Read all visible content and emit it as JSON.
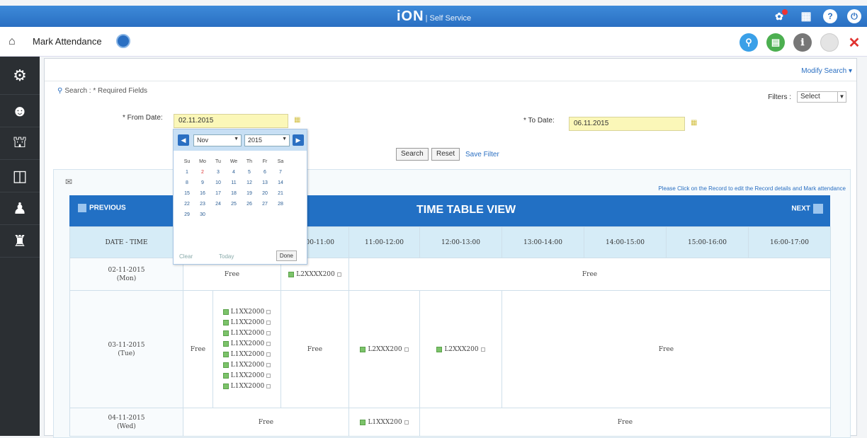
{
  "topbar": {
    "brand": "iON",
    "brand_sub": "| Self Service"
  },
  "header": {
    "title": "Mark Attendance"
  },
  "search": {
    "modify_label": "Modify Search ▾",
    "heading": "Search : * Required Fields",
    "filters_label": "Filters :",
    "filters_value": "Select",
    "from_label": "* From Date:",
    "from_value": "02.11.2015",
    "to_label": "* To Date:",
    "to_value": "06.11.2015",
    "search_btn": "Search",
    "reset_btn": "Reset",
    "save_filter": "Save Filter"
  },
  "datepicker": {
    "month": "Nov",
    "year": "2015",
    "weekdays": [
      "Su",
      "Mo",
      "Tu",
      "We",
      "Th",
      "Fr",
      "Sa"
    ],
    "weeks": [
      [
        "1",
        "2",
        "3",
        "4",
        "5",
        "6",
        "7"
      ],
      [
        "8",
        "9",
        "10",
        "11",
        "12",
        "13",
        "14"
      ],
      [
        "15",
        "16",
        "17",
        "18",
        "19",
        "20",
        "21"
      ],
      [
        "22",
        "23",
        "24",
        "25",
        "26",
        "27",
        "28"
      ],
      [
        "29",
        "30",
        "",
        "",
        "",
        "",
        ""
      ]
    ],
    "clear": "Clear",
    "today": "Today",
    "done": "Done"
  },
  "timetable": {
    "note": "Please Click on the Record to edit the Record details and Mark attendance",
    "prev": "PREVIOUS",
    "title": "TIME TABLE VIEW",
    "next": "NEXT",
    "date_header": "DATE - TIME",
    "time_headers": [
      "",
      "",
      "10:00-11:00",
      "11:00-12:00",
      "12:00-13:00",
      "13:00-14:00",
      "14:00-15:00",
      "15:00-16:00",
      "16:00-17:00"
    ],
    "rows": [
      {
        "date": "02-11-2015",
        "day": "(Mon)",
        "free1": "Free",
        "slot": "L2XXXX200",
        "free2": "Free"
      },
      {
        "date": "03-11-2015",
        "day": "(Tue)",
        "free_a": "Free",
        "slots": [
          "L1XX2000",
          "L1XX2000",
          "L1XX2000",
          "L1XX2000",
          "L1XX2000",
          "L1XX2000",
          "L1XX2000",
          "L1XX2000"
        ],
        "free_b": "Free",
        "slot_c": "L2XXX200",
        "slot_d": "L2XXX200",
        "free_c": "Free"
      },
      {
        "date": "04-11-2015",
        "day": "(Wed)",
        "free1": "Free",
        "slot": "L1XXX200",
        "free2": "Free"
      }
    ]
  }
}
